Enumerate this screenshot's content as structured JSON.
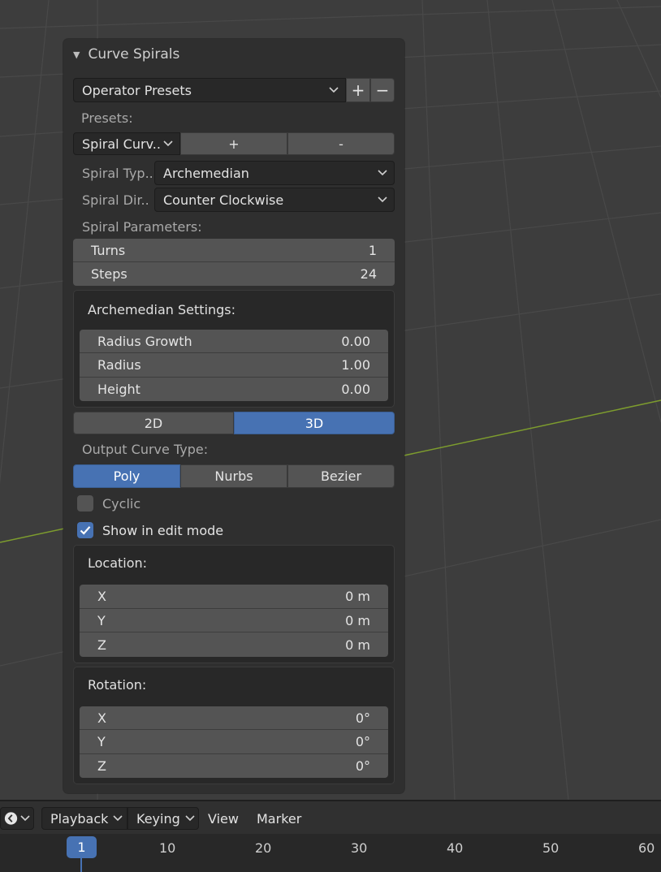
{
  "panel": {
    "title": "Curve Spirals",
    "operator_presets": "Operator Presets",
    "add_symbol": "+",
    "remove_symbol": "−",
    "presets_label": "Presets:",
    "spiral_preset": "Spiral Curv..",
    "preset_add": "+",
    "preset_remove": "-",
    "spiral_type_label": "Spiral Typ..",
    "spiral_type_value": "Archemedian",
    "spiral_dir_label": "Spiral Dir..",
    "spiral_dir_value": "Counter Clockwise",
    "spiral_params_label": "Spiral Parameters:",
    "turns_label": "Turns",
    "turns_value": "1",
    "steps_label": "Steps",
    "steps_value": "24",
    "arch_settings_title": "Archemedian Settings:",
    "radius_growth_label": "Radius Growth",
    "radius_growth_value": "0.00",
    "radius_label": "Radius",
    "radius_value": "1.00",
    "height_label": "Height",
    "height_value": "0.00",
    "mode_2d": "2D",
    "mode_3d": "3D",
    "active_mode": "3D",
    "output_curve_label": "Output Curve Type:",
    "curve_types": [
      "Poly",
      "Nurbs",
      "Bezier"
    ],
    "active_curve_type": "Poly",
    "cyclic_label": "Cyclic",
    "cyclic_checked": false,
    "show_edit_label": "Show in edit mode",
    "show_edit_checked": true,
    "location_title": "Location:",
    "location": [
      {
        "axis": "X",
        "value": "0 m"
      },
      {
        "axis": "Y",
        "value": "0 m"
      },
      {
        "axis": "Z",
        "value": "0 m"
      }
    ],
    "rotation_title": "Rotation:",
    "rotation": [
      {
        "axis": "X",
        "value": "0°"
      },
      {
        "axis": "Y",
        "value": "0°"
      },
      {
        "axis": "Z",
        "value": "0°"
      }
    ]
  },
  "timeline": {
    "editor_icon": "clock-icon",
    "playback": "Playback",
    "keying": "Keying",
    "view": "View",
    "marker": "Marker",
    "current_frame": "1",
    "ticks": [
      "10",
      "20",
      "30",
      "40",
      "50",
      "60"
    ]
  },
  "colors": {
    "accent": "#4772b3",
    "panel_bg": "#2f2f2f",
    "viewport_bg": "#3d3d3d",
    "x_axis_line": "#7d9c2e"
  }
}
